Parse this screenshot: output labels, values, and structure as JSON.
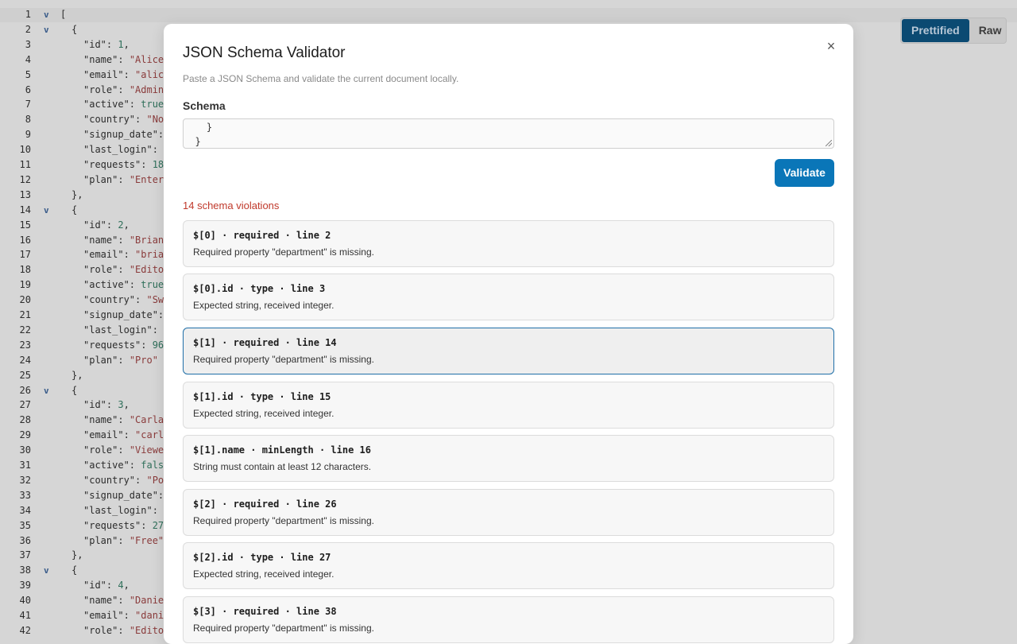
{
  "editor": {
    "view_toggle": {
      "prettified": "Prettified",
      "raw": "Raw",
      "active": "Prettified"
    },
    "lines": [
      {
        "n": "1",
        "fold": "v",
        "indent": 0,
        "parts": [
          [
            "p",
            "["
          ]
        ]
      },
      {
        "n": "2",
        "fold": "v",
        "indent": 1,
        "parts": [
          [
            "p",
            "{"
          ]
        ]
      },
      {
        "n": "3",
        "indent": 2,
        "parts": [
          [
            "k",
            "\"id\""
          ],
          [
            "p",
            ": "
          ],
          [
            "n",
            "1"
          ],
          [
            "p",
            ","
          ]
        ]
      },
      {
        "n": "4",
        "indent": 2,
        "parts": [
          [
            "k",
            "\"name\""
          ],
          [
            "p",
            ": "
          ],
          [
            "s",
            "\"Alice"
          ]
        ]
      },
      {
        "n": "5",
        "indent": 2,
        "parts": [
          [
            "k",
            "\"email\""
          ],
          [
            "p",
            ": "
          ],
          [
            "s",
            "\"alic"
          ]
        ]
      },
      {
        "n": "6",
        "indent": 2,
        "parts": [
          [
            "k",
            "\"role\""
          ],
          [
            "p",
            ": "
          ],
          [
            "s",
            "\"Admin"
          ]
        ]
      },
      {
        "n": "7",
        "indent": 2,
        "parts": [
          [
            "k",
            "\"active\""
          ],
          [
            "p",
            ": "
          ],
          [
            "n",
            "true"
          ]
        ]
      },
      {
        "n": "8",
        "indent": 2,
        "parts": [
          [
            "k",
            "\"country\""
          ],
          [
            "p",
            ": "
          ],
          [
            "s",
            "\"No"
          ]
        ]
      },
      {
        "n": "9",
        "indent": 2,
        "parts": [
          [
            "k",
            "\"signup_date\""
          ],
          [
            "p",
            ":"
          ]
        ]
      },
      {
        "n": "10",
        "indent": 2,
        "parts": [
          [
            "k",
            "\"last_login\""
          ],
          [
            "p",
            ":"
          ]
        ]
      },
      {
        "n": "11",
        "indent": 2,
        "parts": [
          [
            "k",
            "\"requests\""
          ],
          [
            "p",
            ": "
          ],
          [
            "n",
            "18"
          ]
        ]
      },
      {
        "n": "12",
        "indent": 2,
        "parts": [
          [
            "k",
            "\"plan\""
          ],
          [
            "p",
            ": "
          ],
          [
            "s",
            "\"Enter"
          ]
        ]
      },
      {
        "n": "13",
        "indent": 1,
        "parts": [
          [
            "p",
            "},"
          ]
        ]
      },
      {
        "n": "14",
        "fold": "v",
        "indent": 1,
        "parts": [
          [
            "p",
            "{"
          ]
        ]
      },
      {
        "n": "15",
        "indent": 2,
        "parts": [
          [
            "k",
            "\"id\""
          ],
          [
            "p",
            ": "
          ],
          [
            "n",
            "2"
          ],
          [
            "p",
            ","
          ]
        ]
      },
      {
        "n": "16",
        "indent": 2,
        "parts": [
          [
            "k",
            "\"name\""
          ],
          [
            "p",
            ": "
          ],
          [
            "s",
            "\"Brian"
          ]
        ]
      },
      {
        "n": "17",
        "indent": 2,
        "parts": [
          [
            "k",
            "\"email\""
          ],
          [
            "p",
            ": "
          ],
          [
            "s",
            "\"bria"
          ]
        ]
      },
      {
        "n": "18",
        "indent": 2,
        "parts": [
          [
            "k",
            "\"role\""
          ],
          [
            "p",
            ": "
          ],
          [
            "s",
            "\"Edito"
          ]
        ]
      },
      {
        "n": "19",
        "indent": 2,
        "parts": [
          [
            "k",
            "\"active\""
          ],
          [
            "p",
            ": "
          ],
          [
            "n",
            "true"
          ]
        ]
      },
      {
        "n": "20",
        "indent": 2,
        "parts": [
          [
            "k",
            "\"country\""
          ],
          [
            "p",
            ": "
          ],
          [
            "s",
            "\"Sw"
          ]
        ]
      },
      {
        "n": "21",
        "indent": 2,
        "parts": [
          [
            "k",
            "\"signup_date\""
          ],
          [
            "p",
            ":"
          ]
        ]
      },
      {
        "n": "22",
        "indent": 2,
        "parts": [
          [
            "k",
            "\"last_login\""
          ],
          [
            "p",
            ":"
          ]
        ]
      },
      {
        "n": "23",
        "indent": 2,
        "parts": [
          [
            "k",
            "\"requests\""
          ],
          [
            "p",
            ": "
          ],
          [
            "n",
            "96"
          ]
        ]
      },
      {
        "n": "24",
        "indent": 2,
        "parts": [
          [
            "k",
            "\"plan\""
          ],
          [
            "p",
            ": "
          ],
          [
            "s",
            "\"Pro\""
          ]
        ]
      },
      {
        "n": "25",
        "indent": 1,
        "parts": [
          [
            "p",
            "},"
          ]
        ]
      },
      {
        "n": "26",
        "fold": "v",
        "indent": 1,
        "parts": [
          [
            "p",
            "{"
          ]
        ]
      },
      {
        "n": "27",
        "indent": 2,
        "parts": [
          [
            "k",
            "\"id\""
          ],
          [
            "p",
            ": "
          ],
          [
            "n",
            "3"
          ],
          [
            "p",
            ","
          ]
        ]
      },
      {
        "n": "28",
        "indent": 2,
        "parts": [
          [
            "k",
            "\"name\""
          ],
          [
            "p",
            ": "
          ],
          [
            "s",
            "\"Carla"
          ]
        ]
      },
      {
        "n": "29",
        "indent": 2,
        "parts": [
          [
            "k",
            "\"email\""
          ],
          [
            "p",
            ": "
          ],
          [
            "s",
            "\"carl"
          ]
        ]
      },
      {
        "n": "30",
        "indent": 2,
        "parts": [
          [
            "k",
            "\"role\""
          ],
          [
            "p",
            ": "
          ],
          [
            "s",
            "\"Viewe"
          ]
        ]
      },
      {
        "n": "31",
        "indent": 2,
        "parts": [
          [
            "k",
            "\"active\""
          ],
          [
            "p",
            ": "
          ],
          [
            "n",
            "fals"
          ]
        ]
      },
      {
        "n": "32",
        "indent": 2,
        "parts": [
          [
            "k",
            "\"country\""
          ],
          [
            "p",
            ": "
          ],
          [
            "s",
            "\"Po"
          ]
        ]
      },
      {
        "n": "33",
        "indent": 2,
        "parts": [
          [
            "k",
            "\"signup_date\""
          ],
          [
            "p",
            ":"
          ]
        ]
      },
      {
        "n": "34",
        "indent": 2,
        "parts": [
          [
            "k",
            "\"last_login\""
          ],
          [
            "p",
            ":"
          ]
        ]
      },
      {
        "n": "35",
        "indent": 2,
        "parts": [
          [
            "k",
            "\"requests\""
          ],
          [
            "p",
            ": "
          ],
          [
            "n",
            "27"
          ]
        ]
      },
      {
        "n": "36",
        "indent": 2,
        "parts": [
          [
            "k",
            "\"plan\""
          ],
          [
            "p",
            ": "
          ],
          [
            "s",
            "\"Free\""
          ]
        ]
      },
      {
        "n": "37",
        "indent": 1,
        "parts": [
          [
            "p",
            "},"
          ]
        ]
      },
      {
        "n": "38",
        "fold": "v",
        "indent": 1,
        "parts": [
          [
            "p",
            "{"
          ]
        ]
      },
      {
        "n": "39",
        "indent": 2,
        "parts": [
          [
            "k",
            "\"id\""
          ],
          [
            "p",
            ": "
          ],
          [
            "n",
            "4"
          ],
          [
            "p",
            ","
          ]
        ]
      },
      {
        "n": "40",
        "indent": 2,
        "parts": [
          [
            "k",
            "\"name\""
          ],
          [
            "p",
            ": "
          ],
          [
            "s",
            "\"Danie"
          ]
        ]
      },
      {
        "n": "41",
        "indent": 2,
        "parts": [
          [
            "k",
            "\"email\""
          ],
          [
            "p",
            ": "
          ],
          [
            "s",
            "\"dani"
          ]
        ]
      },
      {
        "n": "42",
        "indent": 2,
        "parts": [
          [
            "k",
            "\"role\""
          ],
          [
            "p",
            ": "
          ],
          [
            "s",
            "\"Edito"
          ]
        ]
      }
    ]
  },
  "modal": {
    "title": "JSON Schema Validator",
    "close_label": "×",
    "subtitle": "Paste a JSON Schema and validate the current document locally.",
    "schema_label": "Schema",
    "schema_lines": [
      "    }",
      "  }"
    ],
    "validate_label": "Validate",
    "violations_count": "14 schema violations",
    "violations": [
      {
        "head": "$[0] · required · line 2",
        "msg": "Required property \"department\" is missing.",
        "selected": false
      },
      {
        "head": "$[0].id · type · line 3",
        "msg": "Expected string, received integer.",
        "selected": false
      },
      {
        "head": "$[1] · required · line 14",
        "msg": "Required property \"department\" is missing.",
        "selected": true
      },
      {
        "head": "$[1].id · type · line 15",
        "msg": "Expected string, received integer.",
        "selected": false
      },
      {
        "head": "$[1].name · minLength · line 16",
        "msg": "String must contain at least 12 characters.",
        "selected": false
      },
      {
        "head": "$[2] · required · line 26",
        "msg": "Required property \"department\" is missing.",
        "selected": false
      },
      {
        "head": "$[2].id · type · line 27",
        "msg": "Expected string, received integer.",
        "selected": false
      },
      {
        "head": "$[3] · required · line 38",
        "msg": "Required property \"department\" is missing.",
        "selected": false
      }
    ]
  }
}
